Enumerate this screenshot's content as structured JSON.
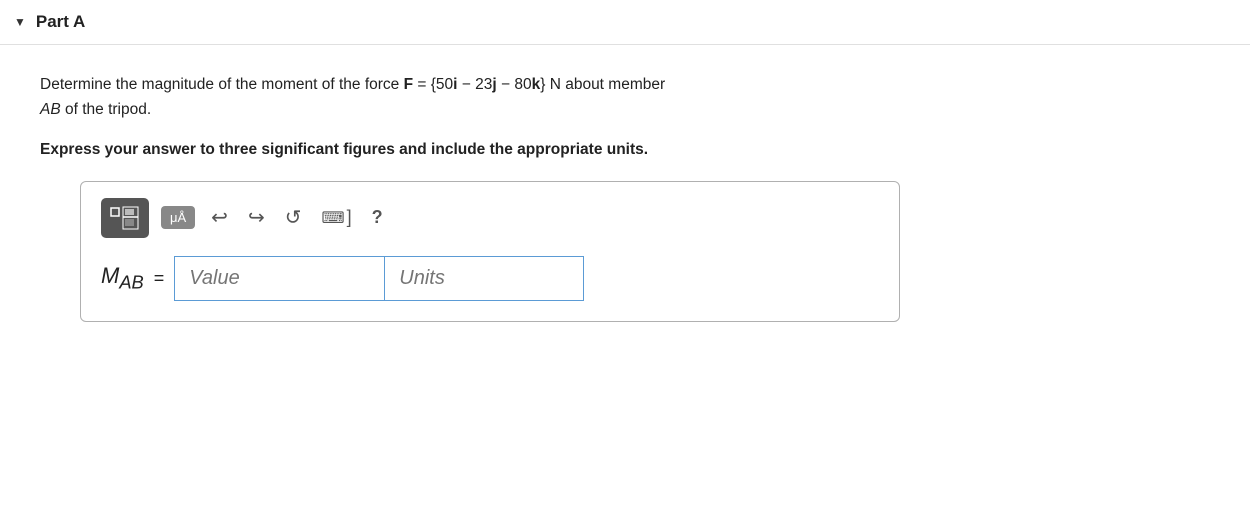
{
  "header": {
    "arrow": "▼",
    "title": "Part A"
  },
  "problem": {
    "text_before": "Determine the magnitude of the moment of the force ",
    "force_label": "F",
    "equals": " = {50",
    "i_vec": "i",
    "minus1": " − 23",
    "j_vec": "j",
    "minus2": " − 80",
    "k_vec": "k",
    "text_after": "} N about member",
    "member_label": "AB",
    "of_tripod": " of the tripod.",
    "instruction": "Express your answer to three significant figures and include the appropriate units."
  },
  "toolbar": {
    "fraction_title": "fraction-button",
    "symbol_label": "μÅ",
    "undo_symbol": "↩",
    "redo_symbol": "↪",
    "refresh_symbol": "↺",
    "keyboard_symbol": "⌨",
    "bracket_symbol": "]",
    "help_symbol": "?"
  },
  "answer": {
    "label_m": "M",
    "label_sub": "AB",
    "equals": "=",
    "value_placeholder": "Value",
    "units_placeholder": "Units"
  }
}
